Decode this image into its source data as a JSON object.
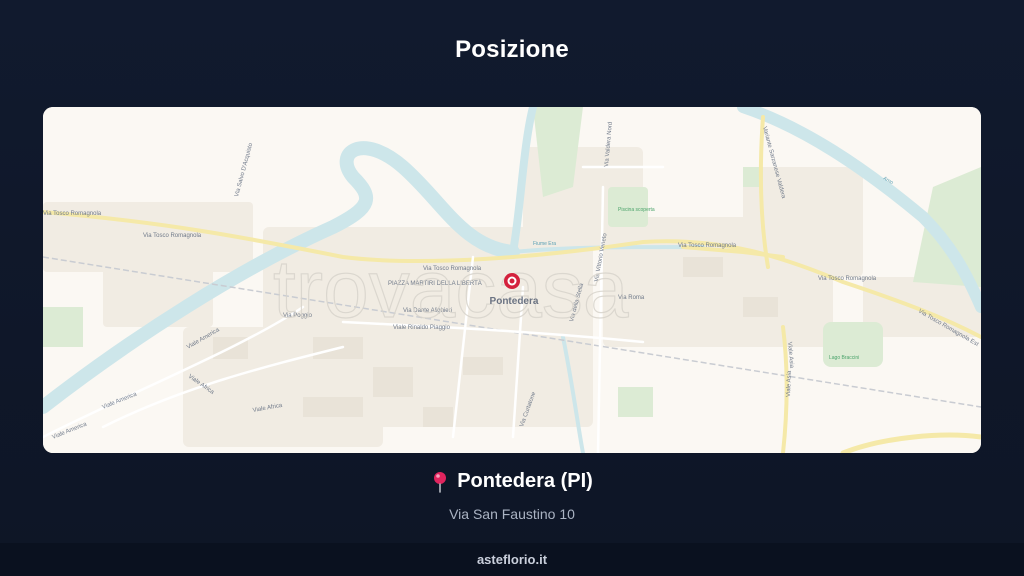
{
  "header": {
    "title": "Posizione"
  },
  "map": {
    "city_label": "Pontedera",
    "watermark": "trovacasa",
    "road_labels": {
      "tosco_romagnola_w": "Via Tosco Romagnola",
      "tosco_romagnola_w2": "Via Tosco Romagnola",
      "tosco_romagnola_c": "Via Tosco Romagnola",
      "tosco_romagnola_e": "Via Tosco Romagnola",
      "tosco_romagnola_ne": "Via Tosco Romagnola",
      "tosco_romagnola_est": "Via Tosco Romagnola Est",
      "america_1": "Viale America",
      "america_2": "Viale America",
      "america_3": "Viale America",
      "africa_1": "Viale Africa",
      "africa_2": "Viale Africa",
      "dante": "Via Dante Alighieri",
      "rinaldo": "Viale Rinaldo Piaggio",
      "valdera_nord": "Via Valdera Nord",
      "variante": "Variante Sarzanese Valdera",
      "aria_1": "Viale Asia",
      "aria_2": "Viale Asia",
      "roma": "Via Roma",
      "veneto": "Via Vittorio Veneto",
      "della_stella": "Via della Stella",
      "chiesa": "Via Salvo D'Acquisto",
      "piazza": "PIAZZA MARTIRI DELLA LIBERTÀ",
      "via_sacchi": "Via Poggio",
      "curtatone": "Via Curtatone",
      "era": "Fiume Era",
      "arno": "Arno"
    },
    "green_labels": {
      "piscina": "Piscina scoperta",
      "lago": "Lago Braccini"
    }
  },
  "location": {
    "pin_icon": "map-pin-icon",
    "place": "Pontedera (PI)",
    "address": "Via San Faustino 10"
  },
  "footer": {
    "brand": "asteflorio.it"
  },
  "colors": {
    "background": "#111a2e",
    "map_land": "#fbf8f3",
    "water": "#cde6ea",
    "road_major": "#f5e9a8",
    "green": "#dcebd4",
    "pin": "#d4213d"
  }
}
